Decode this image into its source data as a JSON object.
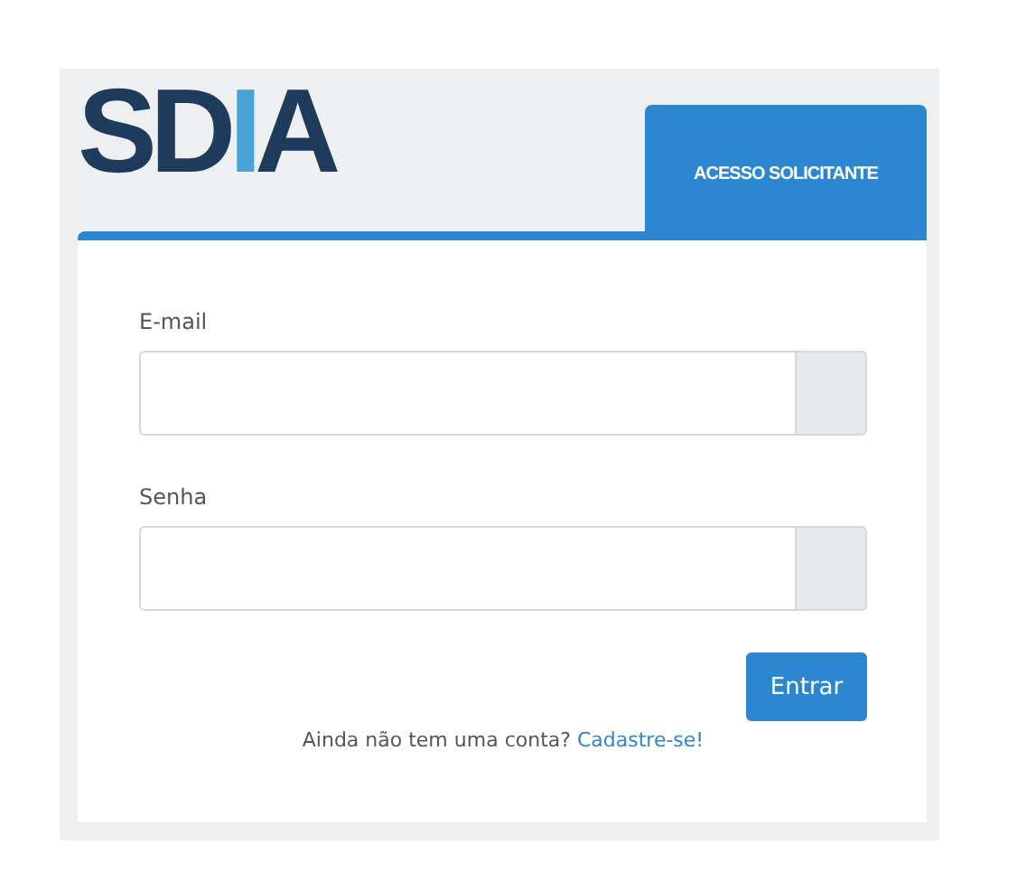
{
  "logo": {
    "parts": [
      {
        "text": "SD",
        "accent": false
      },
      {
        "text": "I",
        "accent": true
      },
      {
        "text": "A",
        "accent": false
      }
    ]
  },
  "tabs": [
    {
      "label": "ACESSO SOLICITANTE",
      "selected": true
    }
  ],
  "fields": [
    {
      "label": "E-mail"
    },
    {
      "label": "Senha"
    }
  ],
  "submit": {
    "label": "Entrar"
  },
  "signup": {
    "text": "Ainda não tem uma conta?",
    "link": "Cadastre-se!"
  }
}
